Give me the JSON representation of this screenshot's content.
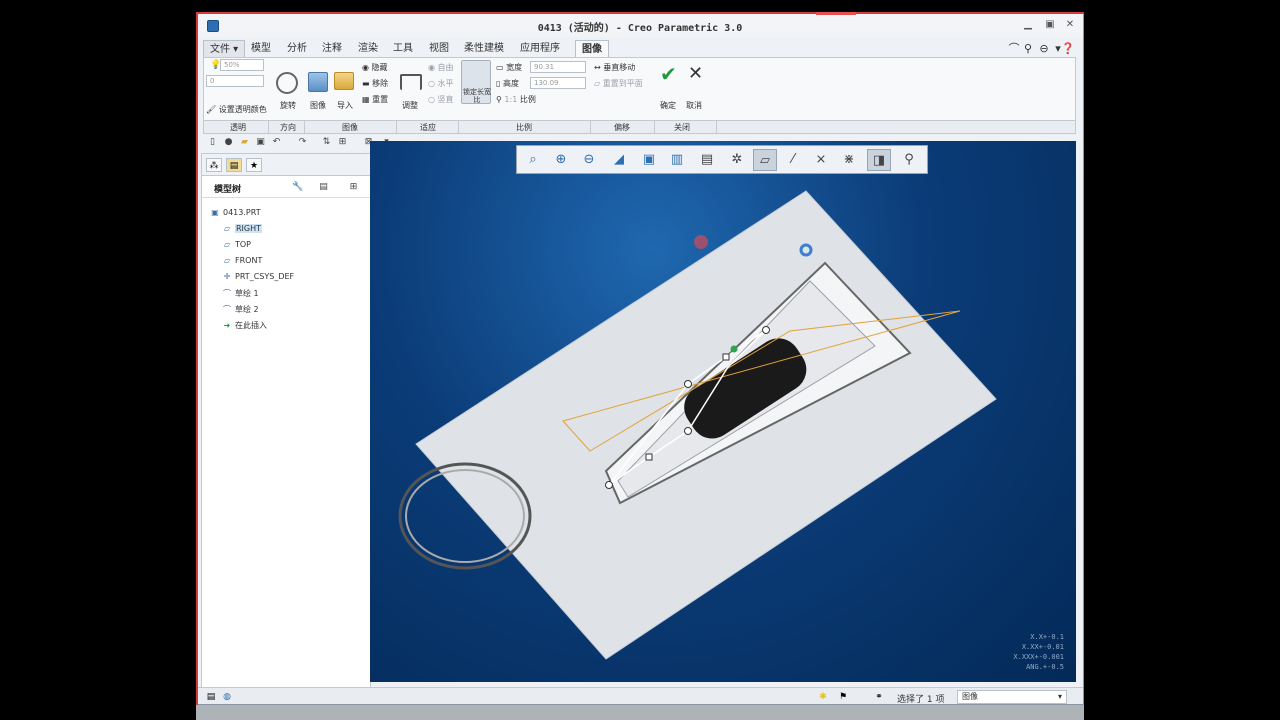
{
  "window": {
    "title": "0413 (活动的) - Creo Parametric 3.0"
  },
  "menu": {
    "file": "文件",
    "tabs": [
      "模型",
      "分析",
      "注释",
      "渲染",
      "工具",
      "视图",
      "柔性建模",
      "应用程序",
      "图像"
    ]
  },
  "ribbon": {
    "transparency_value": "50%",
    "transparency_zero": "0",
    "set_transparency_color": "设置透明颜色",
    "rotate": "旋转",
    "image": "图像",
    "import": "导入",
    "hide": "隐藏",
    "remove": "移除",
    "overlay": "重置",
    "adjust": "调整",
    "free": "自由",
    "horizontal": "水平",
    "vertical": "竖直",
    "lock_aspect": "锁定长宽比",
    "width_label": "宽度",
    "width_value": "90.31",
    "height_label": "高度",
    "height_value": "130.09",
    "scale_prefix": "1:1",
    "scale": "比例",
    "move_vertical": "垂直移动",
    "reset_to_plane": "重置到平面",
    "ok": "确定",
    "cancel": "取消"
  },
  "groups": [
    "透明",
    "方向",
    "图像",
    "适应",
    "比例",
    "偏移",
    "关闭"
  ],
  "model_tree": {
    "header": "模型树",
    "items": [
      {
        "label": "0413.PRT",
        "icon": "part-icon"
      },
      {
        "label": "RIGHT",
        "icon": "datum-plane-icon",
        "selected": true
      },
      {
        "label": "TOP",
        "icon": "datum-plane-icon"
      },
      {
        "label": "FRONT",
        "icon": "datum-plane-icon"
      },
      {
        "label": "PRT_CSYS_DEF",
        "icon": "csys-icon"
      },
      {
        "label": "草绘 1",
        "icon": "sketch-icon"
      },
      {
        "label": "草绘 2",
        "icon": "sketch-icon"
      },
      {
        "label": "在此插入",
        "icon": "insert-arrow-icon"
      }
    ]
  },
  "viewport": {
    "coords": [
      "X.X+-0.1",
      "X.XX+-0.01",
      "X.XXX+-0.001",
      "ANG.+-0.5"
    ]
  },
  "status": {
    "selected": "选择了 1 项",
    "filter": "图像"
  },
  "colors": {
    "accent": "#d23c3c",
    "viewport_top": "#1f68b0",
    "viewport_bottom": "#032a58",
    "ok_green": "#1e9a3c",
    "selection": "#cfe3f7"
  }
}
